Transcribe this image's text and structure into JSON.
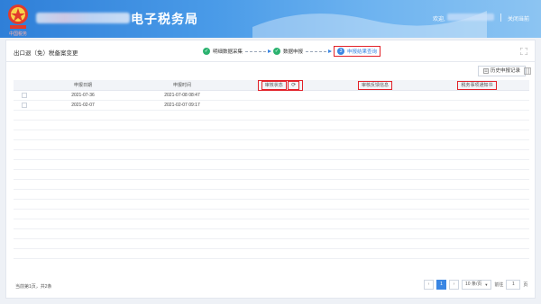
{
  "header": {
    "app_title": "电子税务局",
    "emblem_caption": "中国税务",
    "greeting": "欢迎,",
    "logout": "关闭当前"
  },
  "page": {
    "title": "出口退（免）税备案变更",
    "steps": [
      {
        "label": "明细数据采集",
        "state": "done"
      },
      {
        "label": "数据申报",
        "state": "done"
      },
      {
        "label": "申报结果查询",
        "state": "active",
        "number": "3"
      }
    ]
  },
  "toolbar": {
    "history_button": "历史申报记录"
  },
  "table": {
    "columns": [
      "",
      "申报日期",
      "申报时间",
      "审核状态",
      "审核反馈信息",
      "税务事项通知书"
    ],
    "rows": [
      {
        "date": "2021-07-36",
        "time": "2021-07-08 08:47",
        "status": "",
        "feedback": "",
        "notice": ""
      },
      {
        "date": "2021-02-07",
        "time": "2021-02-07 09:17",
        "status": "",
        "feedback": "",
        "notice": ""
      }
    ],
    "empty_row_count": 15
  },
  "footer": {
    "summary": "当前第1页，共2条",
    "current_page": "1",
    "page_size": "10 条/页",
    "goto_label": "前往",
    "goto_value": "1",
    "page_suffix": "页"
  },
  "colors": {
    "header_blue": "#2f7fd8",
    "step_done": "#2bb26f",
    "step_active": "#3a86e3",
    "highlight_red": "#e2222a"
  }
}
